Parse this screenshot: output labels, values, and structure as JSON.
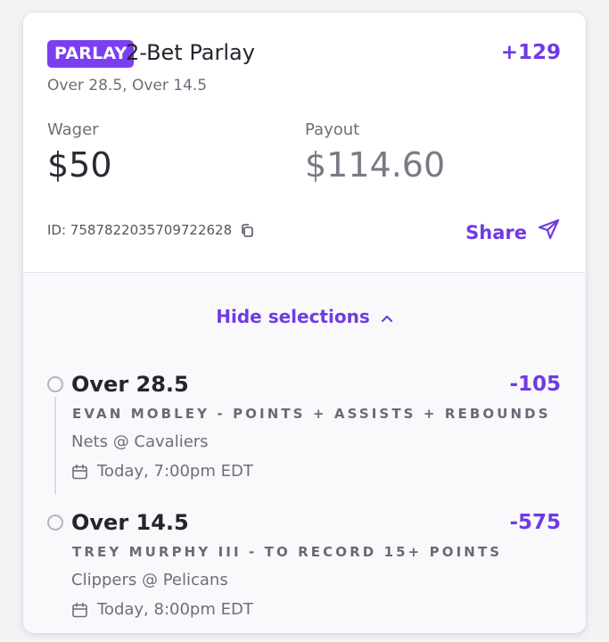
{
  "bet": {
    "badge": "PARLAY",
    "title": "2-Bet Parlay",
    "odds": "+129",
    "subtitle": "Over 28.5, Over 14.5",
    "wager_label": "Wager",
    "wager_value": "$50",
    "payout_label": "Payout",
    "payout_value": "$114.60",
    "id_text": "ID: 7587822035709722628",
    "share_label": "Share",
    "hide_selections_label": "Hide selections"
  },
  "selections": [
    {
      "title": "Over 28.5",
      "odds": "-105",
      "market": "EVAN MOBLEY - POINTS + ASSISTS + REBOUNDS",
      "game": "Nets @ Cavaliers",
      "time": "Today, 7:00pm EDT"
    },
    {
      "title": "Over 14.5",
      "odds": "-575",
      "market": "TREY MURPHY III - TO RECORD 15+ POINTS",
      "game": "Clippers @ Pelicans",
      "time": "Today, 8:00pm EDT"
    }
  ],
  "icons": {
    "copy": "copy-icon",
    "share": "send-icon",
    "collapse": "chevron-up-icon",
    "calendar": "calendar-icon",
    "leg_marker": "circle-icon"
  },
  "colors": {
    "accent": "#6f3be3",
    "badge_bg": "#7b3ff2",
    "muted_text": "#6e6e7a",
    "payout_text": "#7a7a86"
  }
}
